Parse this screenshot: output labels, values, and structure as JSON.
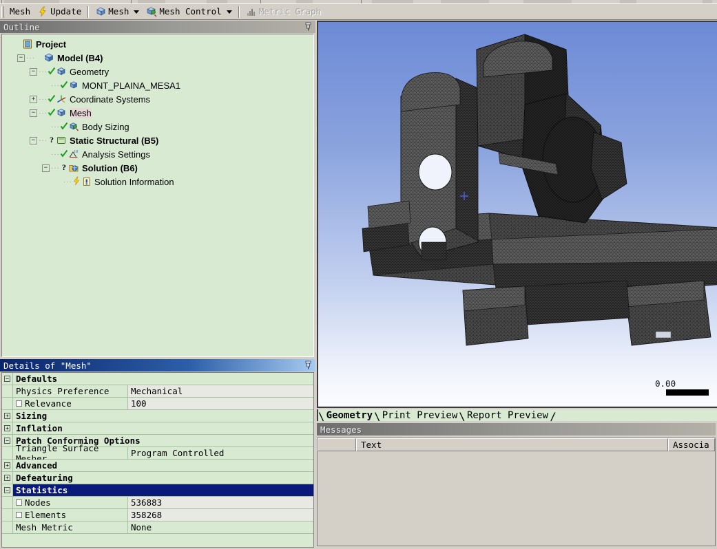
{
  "toolbar": {
    "mesh_menu_label": "Mesh",
    "update_label": "Update",
    "mesh_dropdown_label": "Mesh",
    "mesh_control_label": "Mesh Control",
    "metric_graph_label": "Metric Graph",
    "metric_graph_disabled": true,
    "icons": {
      "update": "lightning-bolt-icon",
      "mesh": "mesh-cube-icon",
      "mesh_control": "mesh-control-icon",
      "metric_graph": "bar-chart-icon"
    }
  },
  "outline": {
    "title": "Outline",
    "pin_icon": "pin-icon",
    "tree": [
      {
        "label": "Project",
        "indent": 0,
        "expander": "none",
        "bold": true,
        "icon": "project-icon",
        "check": "none",
        "selected": false
      },
      {
        "label": "Model (B4)",
        "indent": 1,
        "expander": "minus",
        "bold": true,
        "icon": "model-icon",
        "check": "none",
        "selected": false
      },
      {
        "label": "Geometry",
        "indent": 2,
        "expander": "minus",
        "bold": false,
        "icon": "geometry-icon",
        "check": "green",
        "selected": false
      },
      {
        "label": "MONT_PLAINA_MESA1",
        "indent": 3,
        "expander": "none",
        "bold": false,
        "icon": "body-icon",
        "check": "green",
        "selected": false
      },
      {
        "label": "Coordinate Systems",
        "indent": 2,
        "expander": "plus",
        "bold": false,
        "icon": "coordsys-icon",
        "check": "green",
        "selected": false
      },
      {
        "label": "Mesh",
        "indent": 2,
        "expander": "minus",
        "bold": false,
        "icon": "mesh-tree-icon",
        "check": "green",
        "selected": true
      },
      {
        "label": "Body Sizing",
        "indent": 3,
        "expander": "none",
        "bold": false,
        "icon": "bodysizing-icon",
        "check": "green",
        "selected": false
      },
      {
        "label": "Static Structural (B5)",
        "indent": 2,
        "expander": "minus",
        "bold": true,
        "icon": "analysis-icon",
        "check": "question",
        "selected": false
      },
      {
        "label": "Analysis Settings",
        "indent": 3,
        "expander": "none",
        "bold": false,
        "icon": "settings-icon",
        "check": "green",
        "selected": false
      },
      {
        "label": "Solution (B6)",
        "indent": 3,
        "expander": "minus",
        "bold": true,
        "icon": "solution-icon",
        "check": "question",
        "selected": false
      },
      {
        "label": "Solution Information",
        "indent": 4,
        "expander": "none",
        "bold": false,
        "icon": "solutioninfo-icon",
        "check": "bolt",
        "selected": false
      }
    ]
  },
  "details": {
    "title": "Details of \"Mesh\"",
    "pin_icon": "pin-icon",
    "rows": [
      {
        "kind": "header",
        "expander": "minus",
        "label": "Defaults",
        "selected": false
      },
      {
        "kind": "field",
        "checkbox": false,
        "name": "Physics Preference",
        "value": "Mechanical",
        "value_shaded": true
      },
      {
        "kind": "field",
        "checkbox": true,
        "name": "Relevance",
        "value": "100",
        "value_shaded": true
      },
      {
        "kind": "header",
        "expander": "plus",
        "label": "Sizing",
        "selected": false
      },
      {
        "kind": "header",
        "expander": "plus",
        "label": "Inflation",
        "selected": false
      },
      {
        "kind": "header",
        "expander": "minus",
        "label": "Patch Conforming Options",
        "selected": false
      },
      {
        "kind": "field",
        "checkbox": false,
        "name": "Triangle Surface Mesher",
        "value": "Program Controlled",
        "value_shaded": false
      },
      {
        "kind": "header",
        "expander": "plus",
        "label": "Advanced",
        "selected": false
      },
      {
        "kind": "header",
        "expander": "plus",
        "label": "Defeaturing",
        "selected": false
      },
      {
        "kind": "header",
        "expander": "minus",
        "label": "Statistics",
        "selected": true
      },
      {
        "kind": "field",
        "checkbox": true,
        "name": "Nodes",
        "value": "536883",
        "value_shaded": true
      },
      {
        "kind": "field",
        "checkbox": true,
        "name": "Elements",
        "value": "358268",
        "value_shaded": true
      },
      {
        "kind": "field",
        "checkbox": false,
        "name": "Mesh Metric",
        "value": "None",
        "value_shaded": false
      }
    ]
  },
  "viewport": {
    "scale_value": "0.00",
    "scale_bar_icon": "scale-bar",
    "model_name": "MONT_PLAINA_MESA1",
    "background": "#6d8ad6"
  },
  "view_tabs": [
    {
      "label": "Geometry",
      "active": true
    },
    {
      "label": "Print Preview",
      "active": false
    },
    {
      "label": "Report Preview",
      "active": false
    }
  ],
  "messages": {
    "title": "Messages",
    "columns": [
      "",
      "Text",
      "Associa"
    ],
    "rows": []
  },
  "colors": {
    "tree_background": "#d9ead3",
    "selection_navy": "#0a1a7a",
    "panel_chrome": "#d4d0c8",
    "title_active_start": "#0a246a",
    "mesh_grey": "#4a4a4a"
  }
}
